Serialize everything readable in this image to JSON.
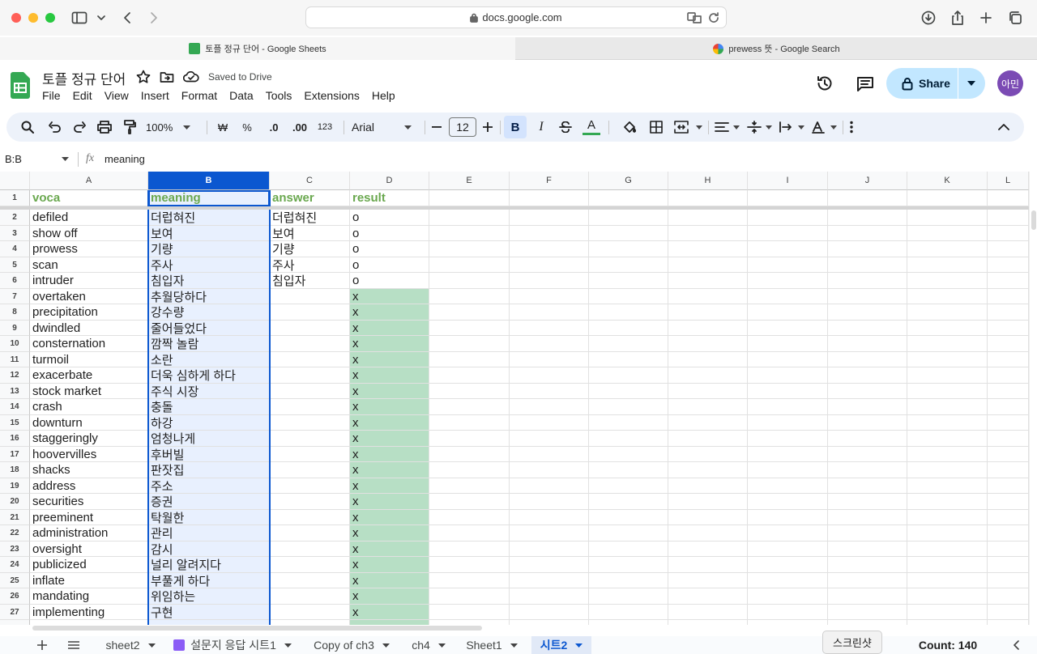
{
  "browser": {
    "url": "docs.google.com",
    "tabs": [
      {
        "label": "토플 정규 단어 - Google Sheets",
        "active": true
      },
      {
        "label": "prewess 뜻 - Google Search",
        "active": false
      }
    ]
  },
  "doc": {
    "title": "토플 정규 단어",
    "save_status": "Saved to Drive",
    "menu": [
      "File",
      "Edit",
      "View",
      "Insert",
      "Format",
      "Data",
      "Tools",
      "Extensions",
      "Help"
    ],
    "share_label": "Share",
    "avatar_label": "아민"
  },
  "toolbar": {
    "zoom": "100%",
    "currency": "₩",
    "percent": "%",
    "decrease_decimal": ".0",
    "increase_decimal": ".00",
    "number_format": "123",
    "font": "Arial",
    "font_size": "12",
    "bold": "B",
    "italic": "I",
    "text_color": "A"
  },
  "formula_bar": {
    "name_box": "B:B",
    "fx": "fx",
    "content": "meaning"
  },
  "grid": {
    "columns": [
      "A",
      "B",
      "C",
      "D",
      "E",
      "F",
      "G",
      "H",
      "I",
      "J",
      "K",
      "L"
    ],
    "selected_column": "B",
    "header_row": [
      "voca",
      "meaning",
      "answer",
      "result"
    ],
    "rows": [
      {
        "n": "2",
        "voca": "defiled",
        "meaning": "더럽혀진",
        "answer": "더럽혀진",
        "result": "o"
      },
      {
        "n": "3",
        "voca": "show off",
        "meaning": "보여",
        "answer": "보여",
        "result": "o"
      },
      {
        "n": "4",
        "voca": "prowess",
        "meaning": "기량",
        "answer": "기량",
        "result": "o"
      },
      {
        "n": "5",
        "voca": "scan",
        "meaning": "주사",
        "answer": "주사",
        "result": "o"
      },
      {
        "n": "6",
        "voca": "intruder",
        "meaning": "침입자",
        "answer": "침입자",
        "result": "o"
      },
      {
        "n": "7",
        "voca": "overtaken",
        "meaning": "추월당하다",
        "answer": "",
        "result": "x"
      },
      {
        "n": "8",
        "voca": "precipitation",
        "meaning": "강수량",
        "answer": "",
        "result": "x"
      },
      {
        "n": "9",
        "voca": "dwindled",
        "meaning": "줄어들었다",
        "answer": "",
        "result": "x"
      },
      {
        "n": "10",
        "voca": "consternation",
        "meaning": "깜짝 놀람",
        "answer": "",
        "result": "x"
      },
      {
        "n": "11",
        "voca": "turmoil",
        "meaning": "소란",
        "answer": "",
        "result": "x"
      },
      {
        "n": "12",
        "voca": "exacerbate",
        "meaning": "더욱 심하게 하다",
        "answer": "",
        "result": "x"
      },
      {
        "n": "13",
        "voca": "stock market",
        "meaning": "주식 시장",
        "answer": "",
        "result": "x"
      },
      {
        "n": "14",
        "voca": "crash",
        "meaning": "충돌",
        "answer": "",
        "result": "x"
      },
      {
        "n": "15",
        "voca": "downturn",
        "meaning": "하강",
        "answer": "",
        "result": "x"
      },
      {
        "n": "16",
        "voca": "staggeringly",
        "meaning": "엄청나게",
        "answer": "",
        "result": "x"
      },
      {
        "n": "17",
        "voca": "hoovervilles",
        "meaning": "후버빌",
        "answer": "",
        "result": "x"
      },
      {
        "n": "18",
        "voca": "shacks",
        "meaning": "판잣집",
        "answer": "",
        "result": "x"
      },
      {
        "n": "19",
        "voca": "address",
        "meaning": "주소",
        "answer": "",
        "result": "x"
      },
      {
        "n": "20",
        "voca": "securities",
        "meaning": "증권",
        "answer": "",
        "result": "x"
      },
      {
        "n": "21",
        "voca": "preeminent",
        "meaning": "탁월한",
        "answer": "",
        "result": "x"
      },
      {
        "n": "22",
        "voca": "administration",
        "meaning": "관리",
        "answer": "",
        "result": "x"
      },
      {
        "n": "23",
        "voca": "oversight",
        "meaning": "감시",
        "answer": "",
        "result": "x"
      },
      {
        "n": "24",
        "voca": "publicized",
        "meaning": "널리 알려지다",
        "answer": "",
        "result": "x"
      },
      {
        "n": "25",
        "voca": "inflate",
        "meaning": "부풀게 하다",
        "answer": "",
        "result": "x"
      },
      {
        "n": "26",
        "voca": "mandating",
        "meaning": "위임하는",
        "answer": "",
        "result": "x"
      },
      {
        "n": "27",
        "voca": "implementing",
        "meaning": "구현",
        "answer": "",
        "result": "x"
      }
    ]
  },
  "sheets": {
    "tabs": [
      {
        "label": "sheet2",
        "active": false
      },
      {
        "label": "설문지 응답 시트1",
        "active": false
      },
      {
        "label": "Copy of ch3",
        "active": false
      },
      {
        "label": "ch4",
        "active": false
      },
      {
        "label": "Sheet1",
        "active": false
      },
      {
        "label": "시트2",
        "active": true
      }
    ],
    "count": "Count: 140",
    "tooltip": "스크린샷"
  },
  "colors": {
    "accent": "#0b57d0",
    "header_text": "#6aa84f",
    "result_fill": "#b7dfc5",
    "selection_fill": "#e8f0fe",
    "share_bg": "#c2e7ff"
  }
}
